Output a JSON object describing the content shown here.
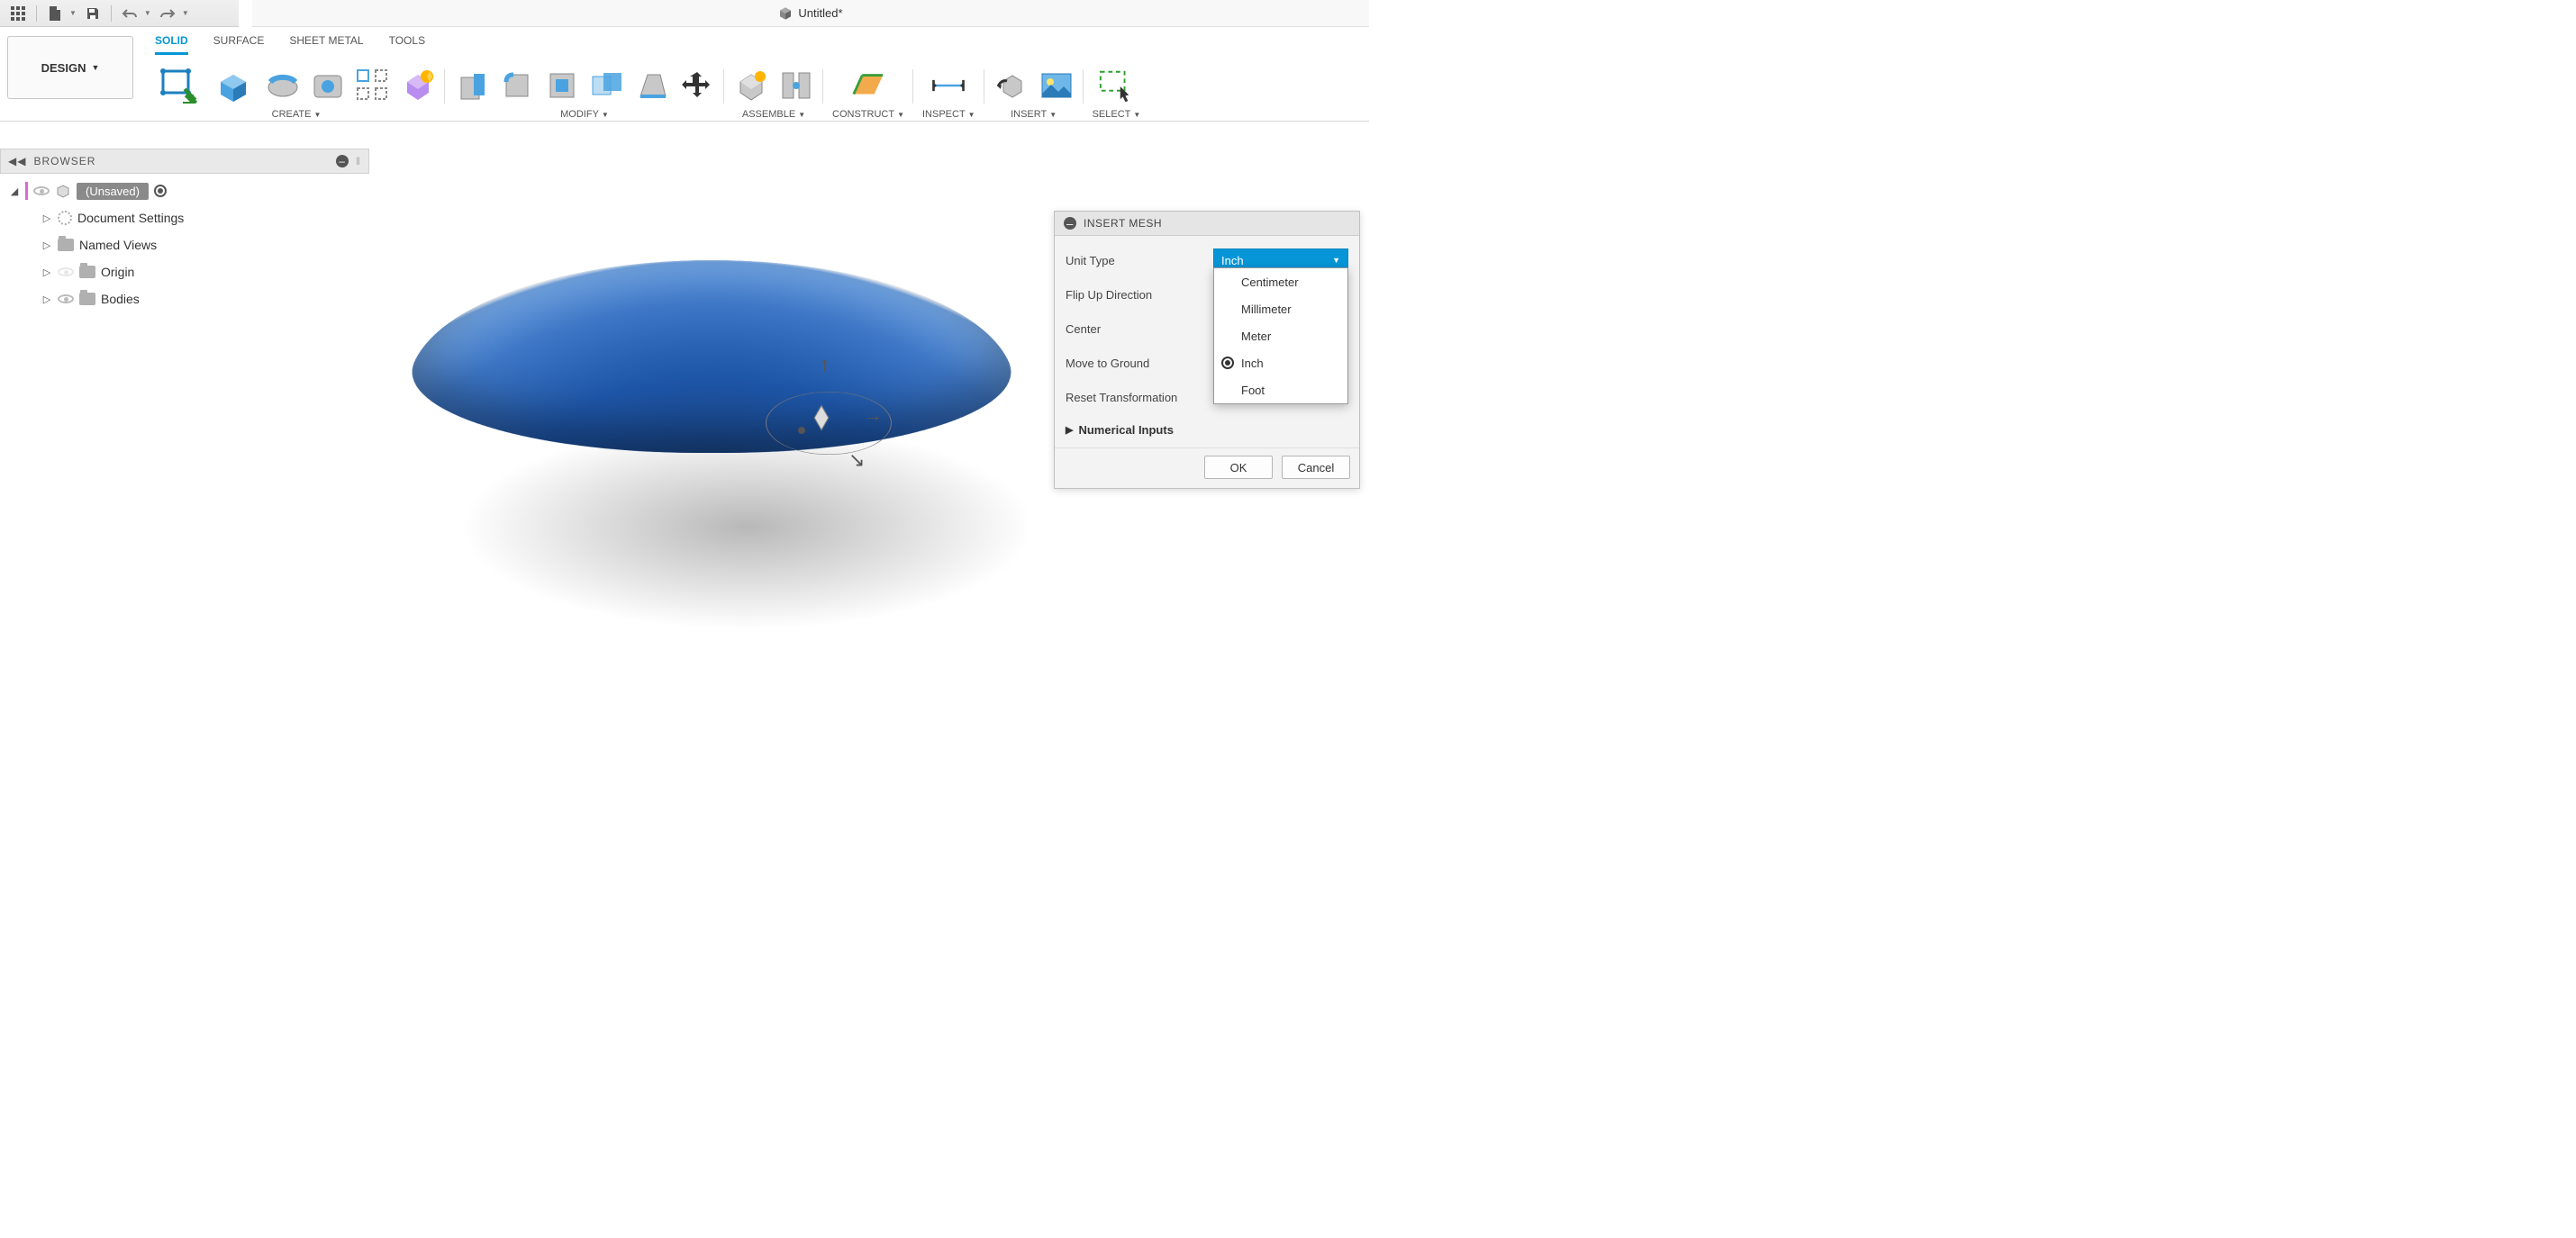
{
  "title": "Untitled*",
  "qat": {
    "gridTip": "Data Panel",
    "fileTip": "File",
    "saveTip": "Save",
    "undoTip": "Undo",
    "redoTip": "Redo"
  },
  "workspace": {
    "label": "DESIGN"
  },
  "tabs": {
    "solid": "SOLID",
    "surface": "SURFACE",
    "sheetmetal": "SHEET METAL",
    "tools": "TOOLS"
  },
  "groupLabels": {
    "create": "CREATE",
    "modify": "MODIFY",
    "assemble": "ASSEMBLE",
    "construct": "CONSTRUCT",
    "inspect": "INSPECT",
    "insert": "INSERT",
    "select": "SELECT"
  },
  "browser": {
    "title": "BROWSER",
    "root": "(Unsaved)",
    "items": [
      {
        "label": "Document Settings"
      },
      {
        "label": "Named Views"
      },
      {
        "label": "Origin"
      },
      {
        "label": "Bodies"
      }
    ]
  },
  "dialog": {
    "title": "INSERT MESH",
    "rows": {
      "unitType": "Unit Type",
      "flip": "Flip Up Direction",
      "center": "Center",
      "ground": "Move to Ground",
      "reset": "Reset Transformation"
    },
    "selectValue": "Inch",
    "options": [
      "Centimeter",
      "Millimeter",
      "Meter",
      "Inch",
      "Foot"
    ],
    "selectedOption": "Inch",
    "section": "Numerical Inputs",
    "ok": "OK",
    "cancel": "Cancel"
  }
}
